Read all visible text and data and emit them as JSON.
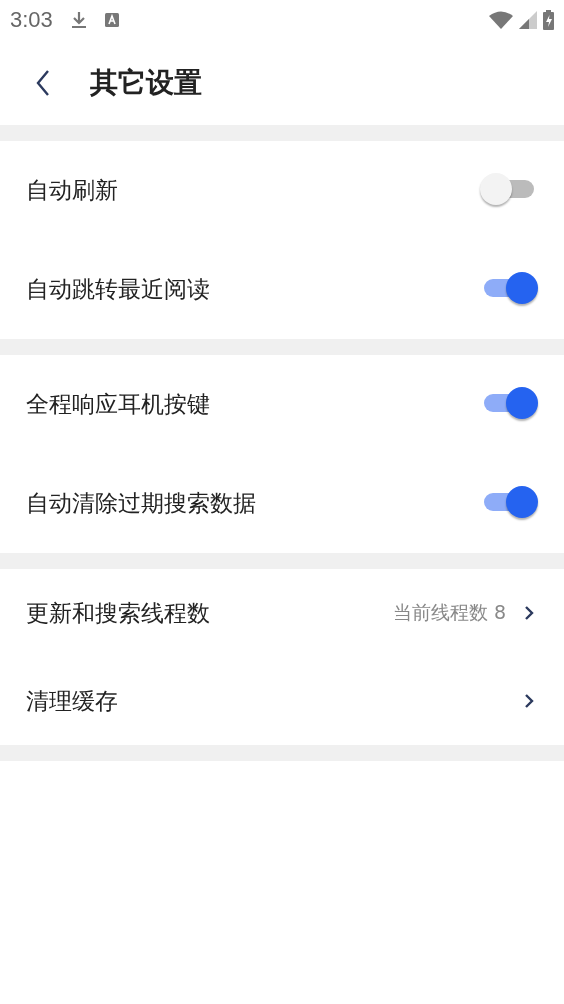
{
  "status_bar": {
    "time": "3:03"
  },
  "header": {
    "title": "其它设置"
  },
  "sections": [
    {
      "items": [
        {
          "kind": "toggle",
          "label": "自动刷新",
          "on": false
        },
        {
          "kind": "toggle",
          "label": "自动跳转最近阅读",
          "on": true
        }
      ]
    },
    {
      "items": [
        {
          "kind": "toggle",
          "label": "全程响应耳机按键",
          "on": true
        },
        {
          "kind": "toggle",
          "label": "自动清除过期搜索数据",
          "on": true
        }
      ]
    },
    {
      "items": [
        {
          "kind": "link",
          "label": "更新和搜索线程数",
          "value": "当前线程数 8"
        },
        {
          "kind": "link",
          "label": "清理缓存"
        }
      ]
    }
  ]
}
